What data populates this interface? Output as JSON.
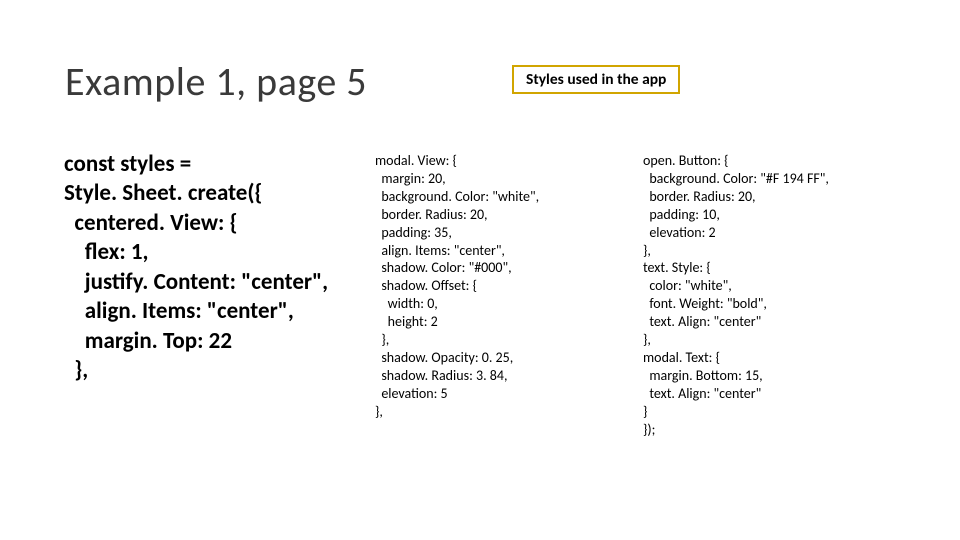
{
  "title": "Example 1, page 5",
  "caption": "Styles used in the app",
  "columns": {
    "col1": "const styles =\nStyle. Sheet. create({\n  centered. View: {\n    flex: 1,\n    justify. Content: \"center\",\n    align. Items: \"center\",\n    margin. Top: 22\n  },",
    "col2": "modal. View: {\n  margin: 20,\n  background. Color: \"white\",\n  border. Radius: 20,\n  padding: 35,\n  align. Items: \"center\",\n  shadow. Color: \"#000\",\n  shadow. Offset: {\n    width: 0,\n    height: 2\n  },\n  shadow. Opacity: 0. 25,\n  shadow. Radius: 3. 84,\n  elevation: 5\n},",
    "col3": "open. Button: {\n  background. Color: \"#F 194 FF\",\n  border. Radius: 20,\n  padding: 10,\n  elevation: 2\n},\ntext. Style: {\n  color: \"white\",\n  font. Weight: \"bold\",\n  text. Align: \"center\"\n},\nmodal. Text: {\n  margin. Bottom: 15,\n  text. Align: \"center\"\n}\n});"
  }
}
